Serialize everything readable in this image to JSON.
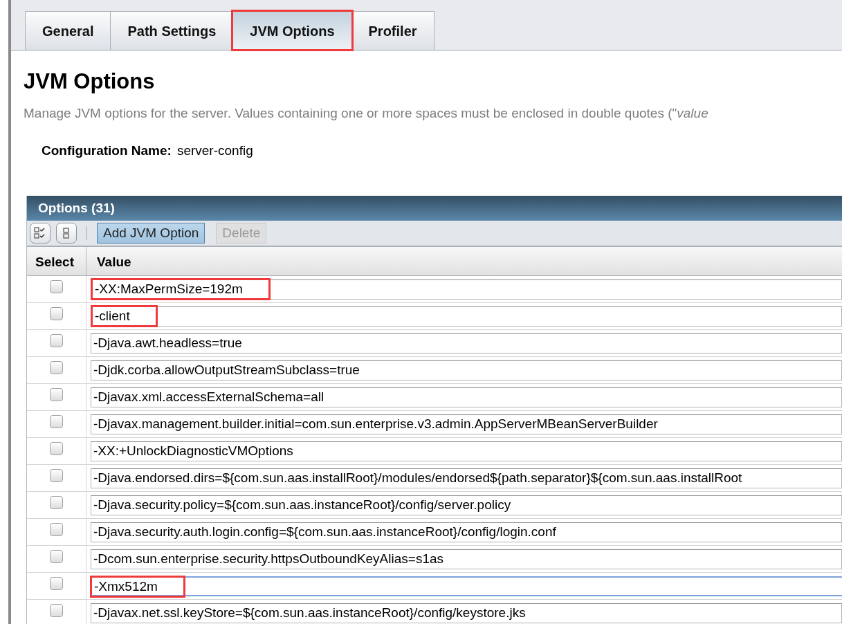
{
  "tabs": [
    {
      "label": "General",
      "selected": false,
      "highlighted": false
    },
    {
      "label": "Path Settings",
      "selected": false,
      "highlighted": false
    },
    {
      "label": "JVM Options",
      "selected": true,
      "highlighted": true
    },
    {
      "label": "Profiler",
      "selected": false,
      "highlighted": false
    }
  ],
  "heading": "JVM Options",
  "description": "Manage JVM options for the server. Values containing one or more spaces must be enclosed in double quotes (\"*value*",
  "configuration": {
    "label": "Configuration Name:",
    "value": "server-config"
  },
  "table": {
    "title": "Options (31)",
    "buttons": [
      {
        "label": "Add JVM Option",
        "disabled": false
      },
      {
        "label": "Delete",
        "disabled": true
      }
    ],
    "columns": [
      "Select",
      "Value"
    ],
    "rows": [
      {
        "checked": false,
        "value": "-XX:MaxPermSize=192m",
        "highlighted": true,
        "focused": false
      },
      {
        "checked": false,
        "value": "-client",
        "highlighted": true,
        "focused": false
      },
      {
        "checked": false,
        "value": "-Djava.awt.headless=true",
        "highlighted": false,
        "focused": false
      },
      {
        "checked": false,
        "value": "-Djdk.corba.allowOutputStreamSubclass=true",
        "highlighted": false,
        "focused": false
      },
      {
        "checked": false,
        "value": "-Djavax.xml.accessExternalSchema=all",
        "highlighted": false,
        "focused": false
      },
      {
        "checked": false,
        "value": "-Djavax.management.builder.initial=com.sun.enterprise.v3.admin.AppServerMBeanServerBuilder",
        "highlighted": false,
        "focused": false
      },
      {
        "checked": false,
        "value": "-XX:+UnlockDiagnosticVMOptions",
        "highlighted": false,
        "focused": false
      },
      {
        "checked": false,
        "value": "-Djava.endorsed.dirs=${com.sun.aas.installRoot}/modules/endorsed${path.separator}${com.sun.aas.installRoot",
        "highlighted": false,
        "focused": false
      },
      {
        "checked": false,
        "value": "-Djava.security.policy=${com.sun.aas.instanceRoot}/config/server.policy",
        "highlighted": false,
        "focused": false
      },
      {
        "checked": false,
        "value": "-Djava.security.auth.login.config=${com.sun.aas.instanceRoot}/config/login.conf",
        "highlighted": false,
        "focused": false
      },
      {
        "checked": false,
        "value": "-Dcom.sun.enterprise.security.httpsOutboundKeyAlias=s1as",
        "highlighted": false,
        "focused": false
      },
      {
        "checked": false,
        "value": "-Xmx512m",
        "highlighted": true,
        "focused": true
      },
      {
        "checked": false,
        "value": "-Djavax.net.ssl.keyStore=${com.sun.aas.instanceRoot}/config/keystore.jks",
        "highlighted": false,
        "focused": false
      }
    ]
  }
}
